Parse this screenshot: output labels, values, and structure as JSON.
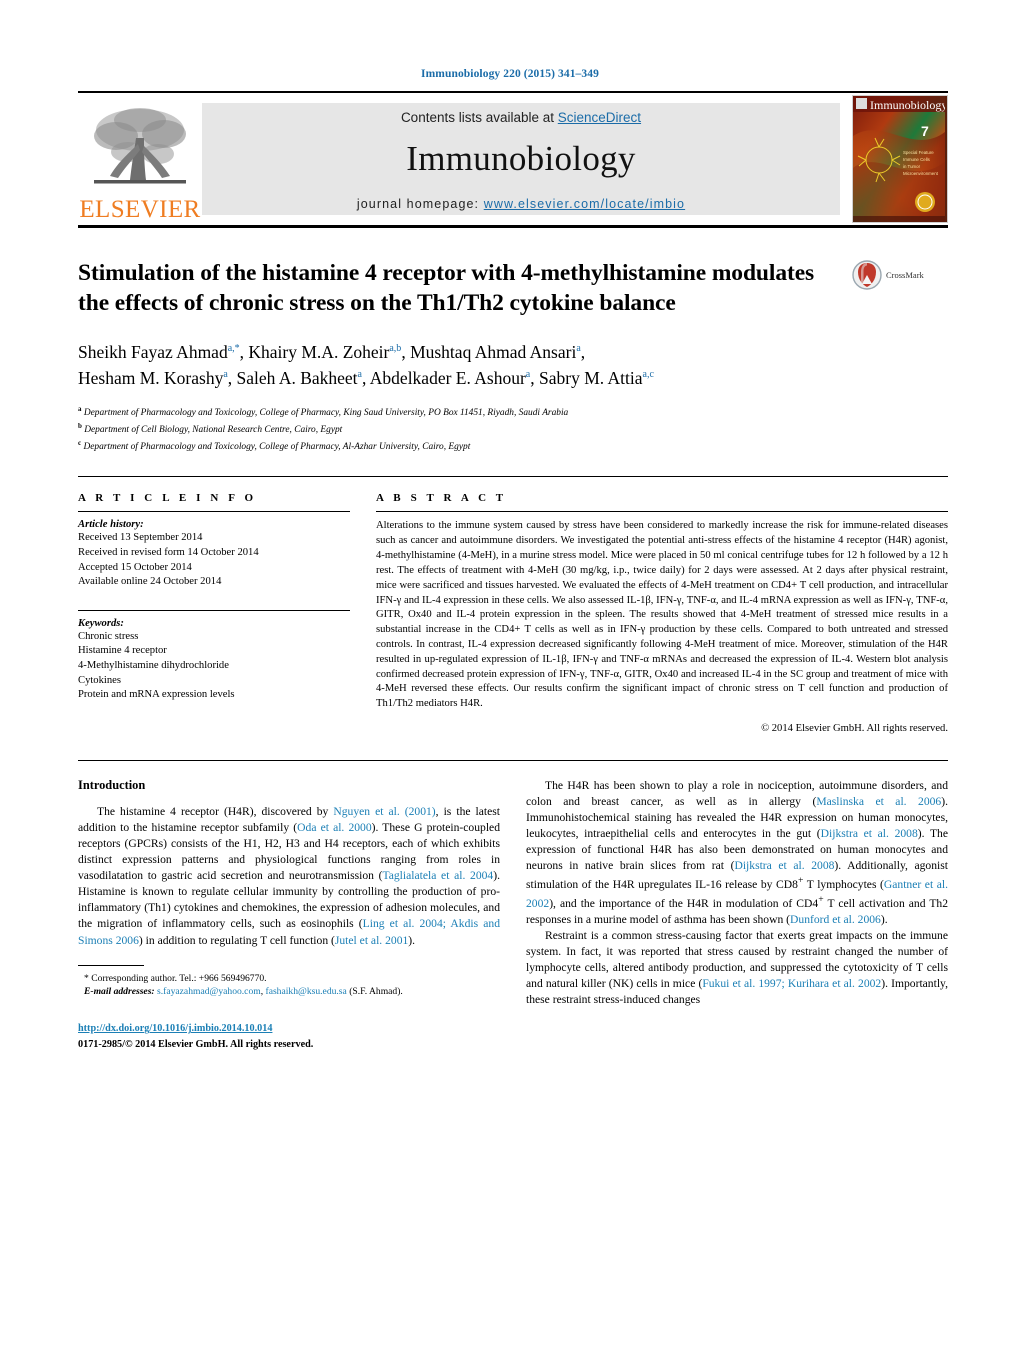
{
  "running_head": "Immunobiology 220 (2015) 341–349",
  "colors": {
    "link_blue": "#1b6ca8",
    "ref_blue": "#1b7fb5",
    "elsevier_orange": "#ef7d22",
    "band_gray": "#e6e6e6"
  },
  "masthead": {
    "publisher": "ELSEVIER",
    "contents_prefix": "Contents lists available at ",
    "contents_link": "ScienceDirect",
    "journal_title": "Immunobiology",
    "homepage_prefix": "journal homepage: ",
    "homepage_url": "www.elsevier.com/locate/imbio",
    "cover_title": "Immunobiology",
    "cover_issue": "7"
  },
  "article": {
    "title": "Stimulation of the histamine 4 receptor with 4-methylhistamine modulates the effects of chronic stress on the Th1/Th2 cytokine balance",
    "crossmark_label": "CrossMark",
    "authors_line1": "Sheikh Fayaz Ahmad",
    "authors_line1_sup": "a,*",
    "authors_line1b": ", Khairy M.A. Zoheir",
    "authors_line1b_sup": "a,b",
    "authors_line1c": ", Mushtaq Ahmad Ansari",
    "authors_line1c_sup": "a",
    "authors_line1d": ",",
    "authors_line2": "Hesham M. Korashy",
    "authors_line2_sup": "a",
    "authors_line2b": ", Saleh A. Bakheet",
    "authors_line2b_sup": "a",
    "authors_line2c": ", Abdelkader E. Ashour",
    "authors_line2c_sup": "a",
    "authors_line2d": ", Sabry M. Attia",
    "authors_line2d_sup": "a,c",
    "affiliations": [
      {
        "marker": "a",
        "text": "Department of Pharmacology and Toxicology, College of Pharmacy, King Saud University, PO Box 11451, Riyadh, Saudi Arabia"
      },
      {
        "marker": "b",
        "text": "Department of Cell Biology, National Research Centre, Cairo, Egypt"
      },
      {
        "marker": "c",
        "text": "Department of Pharmacology and Toxicology, College of Pharmacy, Al-Azhar University, Cairo, Egypt"
      }
    ]
  },
  "article_info": {
    "heading": "A R T I C L E   I N F O",
    "history_label": "Article history:",
    "history": [
      "Received 13 September 2014",
      "Received in revised form 14 October 2014",
      "Accepted 15 October 2014",
      "Available online 24 October 2014"
    ],
    "keywords_label": "Keywords:",
    "keywords": [
      "Chronic stress",
      "Histamine 4 receptor",
      "4-Methylhistamine dihydrochloride",
      "Cytokines",
      "Protein and mRNA expression levels"
    ]
  },
  "abstract": {
    "heading": "A B S T R A C T",
    "text": "Alterations to the immune system caused by stress have been considered to markedly increase the risk for immune-related diseases such as cancer and autoimmune disorders. We investigated the potential anti-stress effects of the histamine 4 receptor (H4R) agonist, 4-methylhistamine (4-MeH), in a murine stress model. Mice were placed in 50 ml conical centrifuge tubes for 12 h followed by a 12 h rest. The effects of treatment with 4-MeH (30 mg/kg, i.p., twice daily) for 2 days were assessed. At 2 days after physical restraint, mice were sacrificed and tissues harvested. We evaluated the effects of 4-MeH treatment on CD4+ T cell production, and intracellular IFN-γ and IL-4 expression in these cells. We also assessed IL-1β, IFN-γ, TNF-α, and IL-4 mRNA expression as well as IFN-γ, TNF-α, GITR, Ox40 and IL-4 protein expression in the spleen. The results showed that 4-MeH treatment of stressed mice results in a substantial increase in the CD4+ T cells as well as in IFN-γ production by these cells. Compared to both untreated and stressed controls. In contrast, IL-4 expression decreased significantly following 4-MeH treatment of mice. Moreover, stimulation of the H4R resulted in up-regulated expression of IL-1β, IFN-γ and TNF-α mRNAs and decreased the expression of IL-4. Western blot analysis confirmed decreased protein expression of IFN-γ, TNF-α, GITR, Ox40 and increased IL-4 in the SC group and treatment of mice with 4-MeH reversed these effects. Our results confirm the significant impact of chronic stress on T cell function and production of Th1/Th2 mediators H4R.",
    "copyright": "© 2014 Elsevier GmbH. All rights reserved."
  },
  "introduction": {
    "heading": "Introduction",
    "left_paragraphs": [
      "The histamine 4 receptor (H4R), discovered by Nguyen et al. (2001), is the latest addition to the histamine receptor subfamily (Oda et al. 2000). These G protein-coupled receptors (GPCRs) consists of the H1, H2, H3 and H4 receptors, each of which exhibits distinct expression patterns and physiological functions ranging from roles in vasodilatation to gastric acid secretion and neurotransmission (Taglialatela et al. 2004). Histamine is known to regulate cellular immunity by controlling the production of pro-inflammatory (Th1) cytokines and chemokines, the expression of adhesion molecules, and the migration of inflammatory cells, such as eosinophils (Ling et al. 2004; Akdis and Simons 2006) in addition to regulating T cell function (Jutel et al. 2001)."
    ],
    "right_paragraphs": [
      "The H4R has been shown to play a role in nociception, autoimmune disorders, and colon and breast cancer, as well as in allergy (Maslinska et al. 2006). Immunohistochemical staining has revealed the H4R expression on human monocytes, leukocytes, intraepithelial cells and enterocytes in the gut (Dijkstra et al. 2008). The expression of functional H4R has also been demonstrated on human monocytes and neurons in native brain slices from rat (Dijkstra et al. 2008). Additionally, agonist stimulation of the H4R upregulates IL-16 release by CD8+ T lymphocytes (Gantner et al. 2002), and the importance of the H4R in modulation of CD4+ T cell activation and Th2 responses in a murine model of asthma has been shown (Dunford et al. 2006).",
      "Restraint is a common stress-causing factor that exerts great impacts on the immune system. In fact, it was reported that stress caused by restraint changed the number of lymphocyte cells, altered antibody production, and suppressed the cytotoxicity of T cells and natural killer (NK) cells in mice (Fukui et al. 1997; Kurihara et al. 2002). Importantly, these restraint stress-induced changes"
    ],
    "citations_left": [
      "Nguyen et al. (2001)",
      "Oda et al. 2000",
      "Taglialatela et al. 2004",
      "Ling et al. 2004; Akdis and Simons 2006",
      "Jutel et al. 2001"
    ],
    "citations_right": [
      "Maslinska et al. 2006",
      "Dijkstra et al. 2008",
      "Gantner et al. 2002",
      "Dunford et al. 2006",
      "Fukui et al. 1997; Kurihara et al. 2002"
    ]
  },
  "footnote": {
    "star": "*",
    "corresponding": "Corresponding author. Tel.: +966 569496770.",
    "email_label": "E-mail addresses:",
    "email1": "s.fayazahmad@yahoo.com",
    "email_sep": ", ",
    "email2": "fashaikh@ksu.edu.sa",
    "email_suffix": " (S.F. Ahmad).",
    "doi": "http://dx.doi.org/10.1016/j.imbio.2014.10.014",
    "issn": "0171-2985/© 2014 Elsevier GmbH. All rights reserved."
  }
}
